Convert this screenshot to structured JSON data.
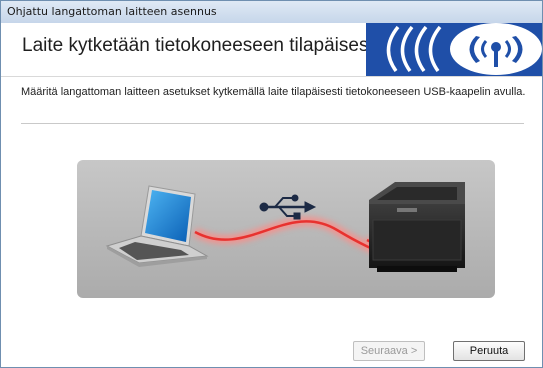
{
  "window": {
    "title": "Ohjattu langattoman laitteen asennus"
  },
  "header": {
    "title": "Laite kytketään tietokoneeseen tilapäisest"
  },
  "main": {
    "description": "Määritä langattoman laitteen asetukset kytkemällä laite tilapäisesti tietokoneeseen USB-kaapelin avulla."
  },
  "illustration": {
    "left_icon": "laptop-icon",
    "center_icon": "usb-icon",
    "right_icon": "printer-icon",
    "cable_color": "#e8322f",
    "background": "#b9b9b9"
  },
  "banner": {
    "icon": "wireless-icon",
    "color": "#1f4fa8"
  },
  "footer": {
    "next_label": "Seuraava >",
    "cancel_label": "Peruuta"
  }
}
